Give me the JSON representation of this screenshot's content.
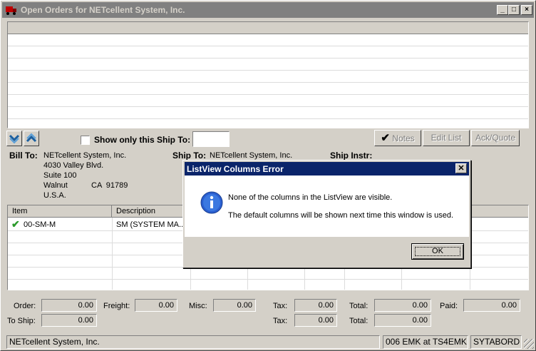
{
  "window": {
    "title": "Open Orders for NETcellent System, Inc."
  },
  "toolbar": {
    "show_only_label": "Show only this Ship To:",
    "shipto_value": "",
    "notes_label": "Notes",
    "edit_list_label": "Edit List",
    "ack_quote_label": "Ack/Quote"
  },
  "bill_to": {
    "label": "Bill To:",
    "name": "NETcellent System, Inc.",
    "address1": "4030 Valley Blvd.",
    "address2": "Suite 100",
    "city": "Walnut",
    "state_zip": "CA  91789",
    "country": "U.S.A."
  },
  "ship_to": {
    "label": "Ship To:",
    "name": "NETcellent System, Inc."
  },
  "ship_instr": {
    "label": "Ship Instr:"
  },
  "items_table": {
    "columns": [
      "Item",
      "Description"
    ],
    "rows": [
      {
        "item": "00-SM-M",
        "description": "SM (SYSTEM MA..."
      }
    ]
  },
  "totals": {
    "order_label": "Order:",
    "order_value": "0.00",
    "freight_label": "Freight:",
    "freight_value": "0.00",
    "misc_label": "Misc:",
    "misc_value": "0.00",
    "tax_label": "Tax:",
    "tax_value": "0.00",
    "total_label": "Total:",
    "total_value": "0.00",
    "paid_label": "Paid:",
    "paid_value": "0.00",
    "toship_label": "To Ship:",
    "toship_value": "0.00",
    "tax2_value": "0.00",
    "total2_value": "0.00"
  },
  "status_bar": {
    "company": "NETcellent System, Inc.",
    "session": "006 EMK at TS4EMK",
    "program": "SYTABORD"
  },
  "dialog": {
    "title": "ListView Columns Error",
    "message1": "None of the columns in the ListView are visible.",
    "message2": "The default columns will be shown next time this window is used.",
    "ok_label": "OK"
  }
}
